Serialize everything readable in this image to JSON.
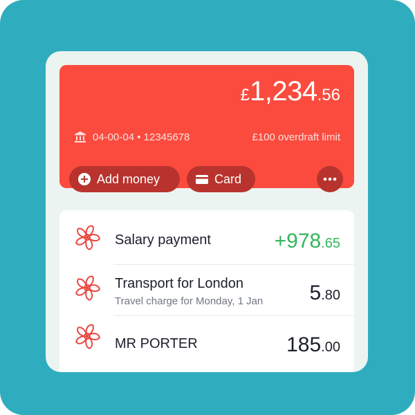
{
  "account": {
    "currency": "£",
    "balance_main": "1,234",
    "balance_frac": ".56",
    "sort_and_account": "04-00-04 • 12345678",
    "overdraft": "£100 overdraft limit",
    "bank_icon": "bank-building-icon"
  },
  "actions": {
    "add_money_label": "Add money",
    "add_money_icon": "plus-circle-icon",
    "card_label": "Card",
    "card_icon": "card-icon",
    "more_icon": "more-dots-icon"
  },
  "transactions": [
    {
      "name": "Salary payment",
      "subtitle": "",
      "amount_main": "+978",
      "amount_frac": ".65",
      "positive": true,
      "icon": "merchant-pinwheel-icon"
    },
    {
      "name": "Transport for London",
      "subtitle": "Travel charge for Monday, 1 Jan",
      "amount_main": "5",
      "amount_frac": ".80",
      "positive": false,
      "icon": "merchant-pinwheel-icon"
    },
    {
      "name": "MR PORTER",
      "subtitle": "",
      "amount_main": "185",
      "amount_frac": ".00",
      "positive": false,
      "icon": "merchant-pinwheel-icon"
    }
  ],
  "colors": {
    "background": "#2fadbf",
    "card": "#fa4b3e",
    "button": "#b8332d",
    "positive": "#33b65c"
  }
}
